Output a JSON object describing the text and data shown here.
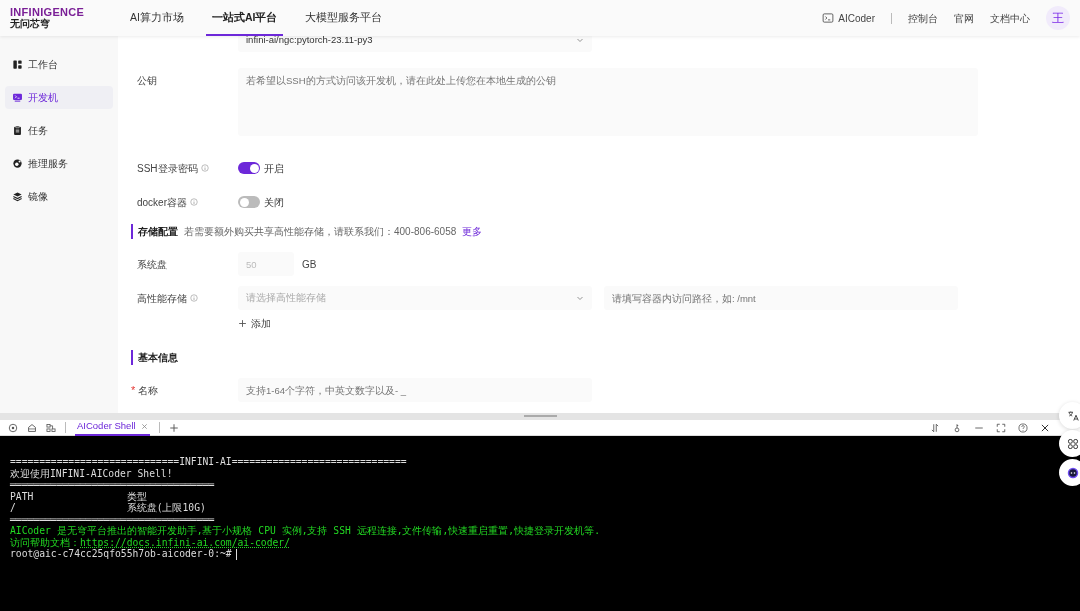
{
  "header": {
    "logo": "INFINIGENCE",
    "logo_sub": "无问芯穹",
    "nav": [
      {
        "label": "AI算力市场",
        "selected": false
      },
      {
        "label": "一站式AI平台",
        "selected": true
      },
      {
        "label": "大模型服务平台",
        "selected": false
      }
    ],
    "aicoder": "AICoder",
    "links": [
      "控制台",
      "官网",
      "文档中心"
    ],
    "avatar": "王"
  },
  "sidebar": {
    "items": [
      {
        "label": "工作台",
        "selected": false
      },
      {
        "label": "开发机",
        "selected": true
      },
      {
        "label": "任务",
        "selected": false
      },
      {
        "label": "推理服务",
        "selected": false
      },
      {
        "label": "镜像",
        "selected": false
      }
    ]
  },
  "form": {
    "rows": [
      {
        "kind": "image_select",
        "value": "infini-ai/ngc:pytorch-23.11-py3"
      },
      {
        "kind": "textarea",
        "label": "公钥",
        "placeholder": "若希望以SSH的方式访问该开发机，请在此处上传您在本地生成的公钥"
      },
      {
        "kind": "switch",
        "label": "SSH登录密码",
        "info": true,
        "on": true,
        "text": "开启"
      },
      {
        "kind": "switch",
        "label": "docker容器",
        "info": true,
        "on": false,
        "text": "关闭"
      },
      {
        "kind": "section",
        "title": "存储配置",
        "note": "若需要额外购买共享高性能存储，请联系我们：400-806-6058",
        "link": "更多"
      },
      {
        "kind": "unit_input",
        "label": "系统盘",
        "value": "50",
        "disabled": true,
        "unit": "GB"
      },
      {
        "kind": "storage",
        "label": "高性能存储",
        "info": true,
        "select_placeholder": "请选择高性能存储",
        "path_placeholder": "请填写容器内访问路径，如: /mnt"
      },
      {
        "kind": "add",
        "text": "添加"
      },
      {
        "kind": "section",
        "title": "基本信息"
      },
      {
        "kind": "text_input",
        "label": "名称",
        "required_mark": "*",
        "placeholder": "支持1-64个字符，中英文数字以及- _"
      }
    ]
  },
  "terminal": {
    "tabs": [
      {
        "label": "AICoder Shell",
        "selected": true
      }
    ],
    "lines": [
      {
        "kind": "plain",
        "text": "=============================INFINI-AI=============================="
      },
      {
        "kind": "plain",
        "text": "欢迎使用INFINI-AICoder Shell!"
      },
      {
        "kind": "rule",
        "text": "═══════════════════════════════════"
      },
      {
        "kind": "plain",
        "text": "PATH                类型"
      },
      {
        "kind": "plain",
        "text": "/                   系统盘(上限10G)"
      },
      {
        "kind": "rule",
        "text": "═══════════════════════════════════"
      },
      {
        "kind": "info",
        "text": "AICoder 是无穹平台推出的智能开发助手,基于小规格 CPU 实例,支持 SSH 远程连接,文件传输,快速重启重置,快捷登录开发机等."
      },
      {
        "kind": "help",
        "text": "访问帮助文档：",
        "link": "https://docs.infini-ai.com/ai-coder/"
      },
      {
        "kind": "prompt",
        "text": "root@aic-c74cc25qfo55h7ob-aicoder-0:~#"
      }
    ]
  }
}
